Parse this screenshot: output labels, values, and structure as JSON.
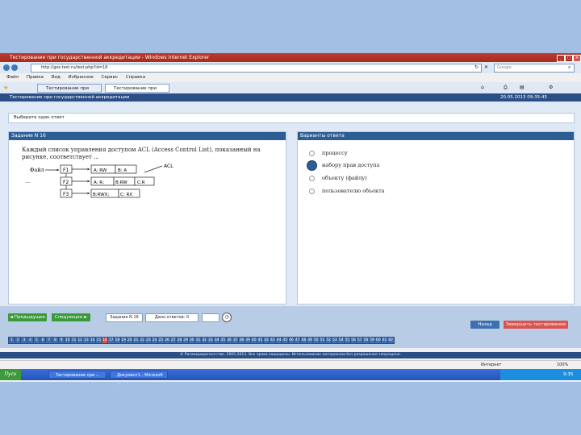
{
  "window": {
    "title": "Тестирование при государственной аккредитации - Windows Internet Explorer"
  },
  "address": {
    "url": "http://gos.test.ru/test.php?id=18",
    "search_placeholder": "Google"
  },
  "menu": {
    "items": [
      "Файл",
      "Правка",
      "Вид",
      "Избранное",
      "Сервис",
      "Справка"
    ]
  },
  "tabs": [
    "Тестирование при гос...",
    "Тестирование при госу..."
  ],
  "app": {
    "header_left": "Тестирование при государственной аккредитации",
    "header_right": "20.05.2013 09:35:45"
  },
  "notice": "Выберите один ответ",
  "question": {
    "header": "Задание N 16",
    "text_line1": "Каждый список управления доступом ACL (Access Control List), показанный на",
    "text_line2": "рисунке, соответствует ...",
    "diagram": {
      "file_label": "Файл",
      "acl_label": "ACL",
      "dots": "...",
      "rows": [
        {
          "file": "F1",
          "acl": [
            "A: RW",
            "B: A"
          ]
        },
        {
          "file": "F2",
          "acl": [
            "A: R;",
            "B:RW",
            "C:R"
          ]
        },
        {
          "file": "F3",
          "acl": [
            "B:RWX;",
            "C: RX"
          ]
        }
      ]
    }
  },
  "answers": {
    "header": "Варианты ответа",
    "options": [
      "процессу",
      "набору прав доступа",
      "объекту (файлу)",
      "пользователю объекта"
    ],
    "selected_index": 1
  },
  "nav": {
    "prev_label": "◄ Предыдущее",
    "next_label": "Следующее ►",
    "task_counter": "Задание N 16",
    "answered": "Дано ответов: 0",
    "finish_label": "Завершить тестирование",
    "back_label": "Назад",
    "numbers": [
      "1",
      "2",
      "3",
      "4",
      "5",
      "6",
      "7",
      "8",
      "9",
      "10",
      "11",
      "12",
      "13",
      "14",
      "15",
      "16",
      "17",
      "18",
      "19",
      "20",
      "21",
      "22",
      "23",
      "24",
      "25",
      "26",
      "27",
      "28",
      "29",
      "30",
      "31",
      "32",
      "33",
      "34",
      "35",
      "36",
      "37",
      "38",
      "39",
      "40",
      "41",
      "42",
      "43",
      "44",
      "45",
      "46",
      "47",
      "48",
      "49",
      "50",
      "51",
      "52",
      "53",
      "54",
      "55",
      "56",
      "57",
      "58",
      "59",
      "60",
      "61",
      "62"
    ]
  },
  "footer": "© Росаккредагентство. 2005-2013. Все права защищены. Использование материалов без разрешения запрещено.",
  "status": {
    "zone": "Интернет",
    "zoom": "100%"
  },
  "taskbar": {
    "start": "Пуск",
    "buttons": [
      "Тестирование при ...",
      "Документ1 - Microsoft ..."
    ],
    "clock": "9:35"
  },
  "colors": {
    "accent": "#2d5d95",
    "finish": "#d9534f",
    "nav_green": "#3a9a3a"
  }
}
